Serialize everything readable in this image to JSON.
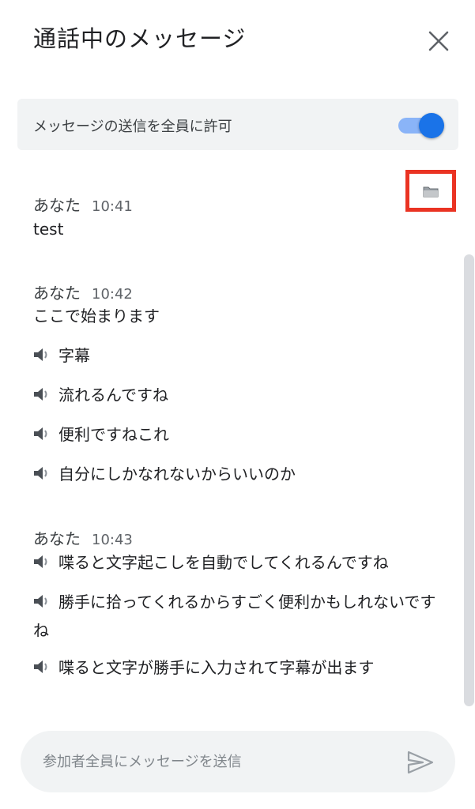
{
  "header": {
    "title": "通話中のメッセージ"
  },
  "settings": {
    "allow_all_label": "メッセージの送信を全員に許可",
    "allow_all_enabled": true
  },
  "messages": [
    {
      "sender": "あなた",
      "time": "10:41",
      "lines": [
        "test"
      ]
    },
    {
      "sender": "あなた",
      "time": "10:42",
      "lines": [
        "ここで始まります",
        "字幕",
        "流れるんですね",
        "便利ですねこれ",
        "自分にしかなれないからいいのか"
      ]
    },
    {
      "sender": "あなた",
      "time": "10:43",
      "lines": [
        "喋ると文字起こしを自動でしてくれるんですね",
        "勝手に拾ってくれるからすごく便利かもしれないですね",
        "喋ると文字が勝手に入力されて字幕が出ます"
      ]
    }
  ],
  "composer": {
    "placeholder": "参加者全員にメッセージを送信"
  },
  "colors": {
    "accent": "#1a73e8",
    "highlight": "#ea3323"
  }
}
